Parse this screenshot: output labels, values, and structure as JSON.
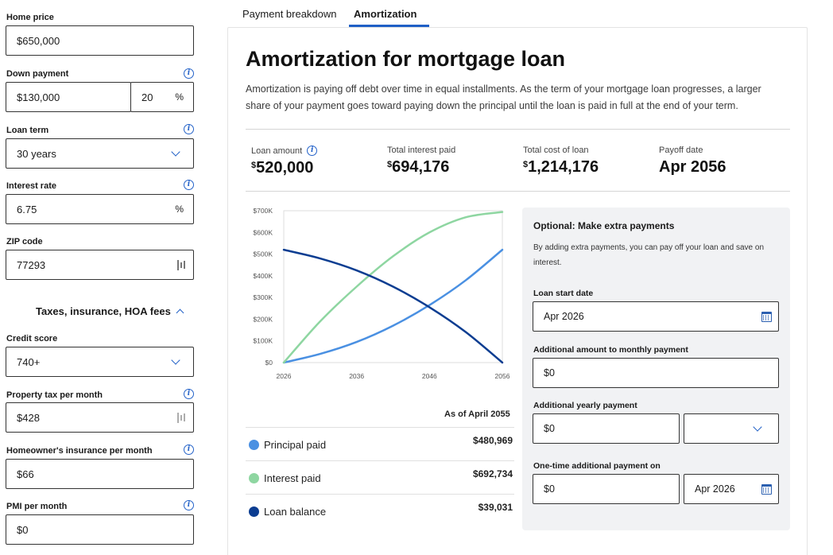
{
  "form": {
    "home_price": {
      "label": "Home price",
      "value": "$650,000"
    },
    "down_payment": {
      "label": "Down payment",
      "value": "$130,000",
      "percent": "20",
      "percent_suffix": "%"
    },
    "loan_term": {
      "label": "Loan term",
      "value": "30 years"
    },
    "interest_rate": {
      "label": "Interest rate",
      "value": "6.75",
      "suffix": "%"
    },
    "zip_code": {
      "label": "ZIP code",
      "value": "77293"
    },
    "section_toggle": "Taxes, insurance, HOA fees",
    "credit_score": {
      "label": "Credit score",
      "value": "740+"
    },
    "property_tax": {
      "label": "Property tax per month",
      "value": "$428"
    },
    "home_insurance": {
      "label": "Homeowner's insurance per month",
      "value": "$66"
    },
    "pmi": {
      "label": "PMI per month",
      "value": "$0"
    }
  },
  "tabs": [
    {
      "label": "Payment breakdown",
      "active": false
    },
    {
      "label": "Amortization",
      "active": true
    }
  ],
  "main": {
    "title": "Amortization for mortgage loan",
    "description": "Amortization is paying off debt over time in equal installments. As the term of your mortgage loan progresses, a larger share of your payment goes toward paying down the principal until the loan is paid in full at the end of your term.",
    "stats": [
      {
        "label": "Loan amount",
        "currency": "$",
        "value": "520,000"
      },
      {
        "label": "Total interest paid",
        "currency": "$",
        "value": "694,176"
      },
      {
        "label": "Total cost of loan",
        "currency": "$",
        "value": "1,214,176"
      },
      {
        "label": "Payoff date",
        "currency": "",
        "value": "Apr 2056"
      }
    ],
    "as_of": "As of April 2055",
    "legend": [
      {
        "name": "Principal paid",
        "value": "$480,969",
        "color": "#4a90e2"
      },
      {
        "name": "Interest paid",
        "value": "$692,734",
        "color": "#8ed6a1"
      },
      {
        "name": "Loan balance",
        "value": "$39,031",
        "color": "#0b3d91"
      }
    ]
  },
  "chart_data": {
    "type": "line",
    "x_ticks": [
      "2026",
      "2036",
      "2046",
      "2056"
    ],
    "y_ticks": [
      "$0",
      "$100K",
      "$200K",
      "$300K",
      "$400K",
      "$500K",
      "$600K",
      "$700K"
    ],
    "ylim": [
      0,
      700000
    ],
    "xlim": [
      2026,
      2056
    ],
    "series": [
      {
        "name": "Principal paid",
        "color": "#4a90e2",
        "x": [
          2026,
          2031,
          2036,
          2041,
          2046,
          2051,
          2056
        ],
        "values": [
          0,
          40000,
          95000,
          170000,
          265000,
          380000,
          520000
        ]
      },
      {
        "name": "Interest paid",
        "color": "#8ed6a1",
        "x": [
          2026,
          2031,
          2036,
          2041,
          2046,
          2051,
          2056
        ],
        "values": [
          0,
          190000,
          350000,
          490000,
          600000,
          670000,
          694000
        ]
      },
      {
        "name": "Loan balance",
        "color": "#0b3d91",
        "x": [
          2026,
          2031,
          2036,
          2041,
          2046,
          2051,
          2056
        ],
        "values": [
          520000,
          480000,
          425000,
          350000,
          255000,
          140000,
          0
        ]
      }
    ]
  },
  "extra": {
    "title": "Optional: Make extra payments",
    "description": "By adding extra payments, you can pay off your loan and save on interest.",
    "start_date": {
      "label": "Loan start date",
      "value": "Apr 2026"
    },
    "monthly": {
      "label": "Additional amount to monthly payment",
      "value": "$0"
    },
    "yearly": {
      "label": "Additional yearly payment",
      "value": "$0",
      "month": ""
    },
    "onetime": {
      "label": "One-time additional payment on",
      "value": "$0",
      "date": "Apr 2026"
    }
  }
}
